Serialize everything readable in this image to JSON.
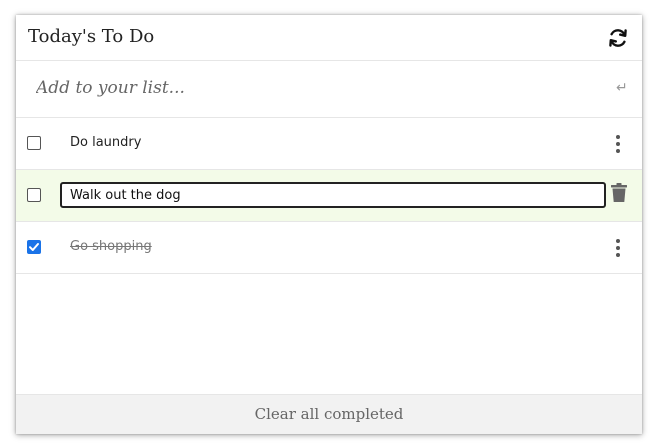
{
  "header": {
    "title": "Today's To Do",
    "refresh_icon": "refresh-icon"
  },
  "add_bar": {
    "placeholder": "Add to your list...",
    "value": "",
    "enter_icon": "↵"
  },
  "todos": [
    {
      "text": "Do laundry",
      "checked": false,
      "editing": false
    },
    {
      "text": "Walk out the dog",
      "checked": false,
      "editing": true
    },
    {
      "text": "Go shopping",
      "checked": true,
      "editing": false
    }
  ],
  "footer": {
    "clear_label": "Clear all completed"
  },
  "colors": {
    "accent": "#1a73e8",
    "editing_row_bg": "#f3fbe8",
    "footer_bg": "#f2f2f2"
  }
}
